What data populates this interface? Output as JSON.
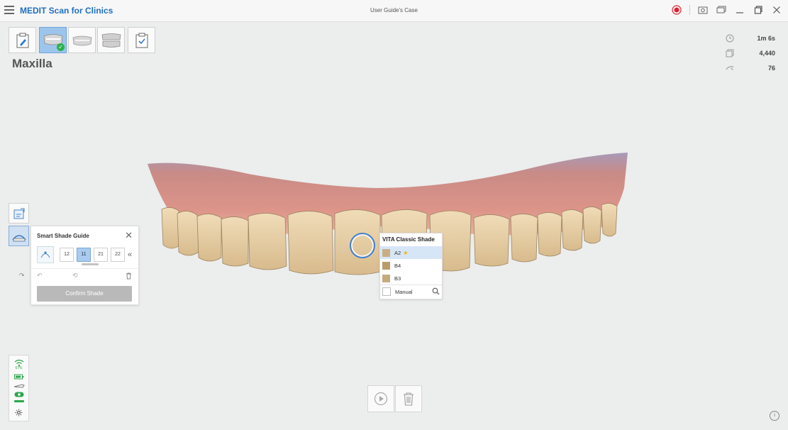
{
  "titlebar": {
    "app_title": "MEDIT Scan for Clinics",
    "case_title": "User Guide's Case"
  },
  "stage_label": "Maxilla",
  "stats": {
    "time": "1m 6s",
    "count": "4,440",
    "rate": "76"
  },
  "smart_shade": {
    "title": "Smart Shade Guide",
    "teeth": [
      "12",
      "11",
      "21",
      "22"
    ],
    "selected_tooth": "11",
    "confirm_label": "Confirm Shade"
  },
  "vita": {
    "title": "VITA Classic Shade",
    "shades": [
      {
        "label": "A2",
        "color": "#c9ae85",
        "recommended": true
      },
      {
        "label": "B4",
        "color": "#b99b6c",
        "recommended": false
      },
      {
        "label": "B3",
        "color": "#c5aa7a",
        "recommended": false
      }
    ],
    "manual_label": "Manual"
  },
  "status": {
    "wifi_percent": "67%"
  },
  "colors": {
    "accent": "#1f6fbf",
    "record": "#e0202e",
    "status_green": "#2ba84a"
  }
}
